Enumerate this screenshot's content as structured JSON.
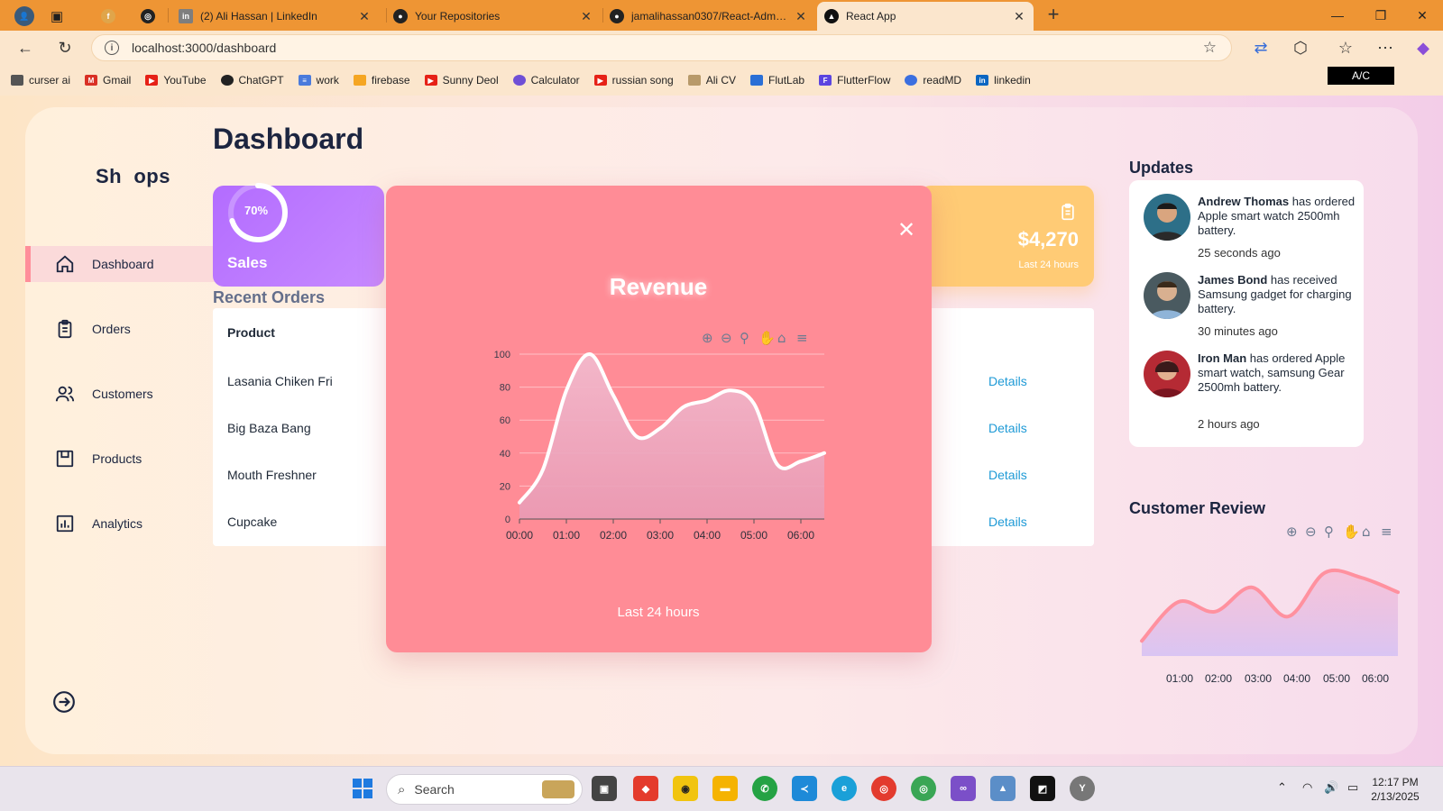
{
  "browser": {
    "tabs": [
      {
        "title": "",
        "kind": "profile"
      },
      {
        "title": "",
        "kind": "workspaces"
      },
      {
        "title": "",
        "kind": "pinned-f"
      },
      {
        "title": "",
        "kind": "pinned-chatgpt"
      },
      {
        "title": "(2) Ali Hassan | LinkedIn",
        "close": "✕"
      },
      {
        "title": "Your Repositories",
        "close": "✕"
      },
      {
        "title": "jamalihassan0307/React-Admin-D",
        "close": "✕"
      },
      {
        "title": "React App",
        "close": "✕"
      }
    ],
    "url": "localhost:3000/dashboard",
    "bookmarks": [
      "curser ai",
      "Gmail",
      "YouTube",
      "ChatGPT",
      "work",
      "firebase",
      "Sunny Deol",
      "Calculator",
      "russian song",
      "Ali CV",
      "FlutLab",
      "FlutterFlow",
      "readMD",
      "linkedin"
    ],
    "ac_label": "A/C"
  },
  "sidebar": {
    "logo": "Sh  ops",
    "items": [
      {
        "label": "Dashboard",
        "icon": "home-icon",
        "active": true
      },
      {
        "label": "Orders",
        "icon": "clipboard-icon",
        "active": false
      },
      {
        "label": "Customers",
        "icon": "users-icon",
        "active": false
      },
      {
        "label": "Products",
        "icon": "package-icon",
        "active": false
      },
      {
        "label": "Analytics",
        "icon": "bar-chart-icon",
        "active": false
      }
    ],
    "logout_icon": "sign-out-icon"
  },
  "main": {
    "title": "Dashboard",
    "cards": {
      "sales": {
        "label": "Sales",
        "percent": "70%",
        "progress": 0.7
      },
      "expenses": {
        "value": "$4,270",
        "sub": "Last 24 hours",
        "icon": "clipboard-icon"
      }
    },
    "recent_orders": {
      "title": "Recent Orders",
      "header": "Product",
      "rows": [
        {
          "product": "Lasania Chiken Fri",
          "action": "Details"
        },
        {
          "product": "Big Baza Bang",
          "action": "Details"
        },
        {
          "product": "Mouth Freshner",
          "action": "Details"
        },
        {
          "product": "Cupcake",
          "action": "Details"
        }
      ]
    }
  },
  "updates": {
    "title": "Updates",
    "items": [
      {
        "name": "Andrew Thomas",
        "text": " has ordered Apple smart watch 2500mh battery.",
        "time": "25 seconds ago"
      },
      {
        "name": "James Bond",
        "text": " has received Samsung gadget for charging battery.",
        "time": "30 minutes ago"
      },
      {
        "name": "Iron Man",
        "text": " has ordered Apple smart watch, samsung Gear 2500mh battery.",
        "time": "2 hours ago"
      }
    ]
  },
  "customer_review": {
    "title": "Customer Review",
    "toolbar_icons": [
      "zoom-in-icon",
      "zoom-out-icon",
      "search-zoom-icon",
      "pan-hand-icon",
      "home-icon",
      "menu-icon"
    ],
    "chart_data": {
      "type": "area",
      "x": [
        "01:00",
        "02:00",
        "03:00",
        "04:00",
        "05:00",
        "06:00"
      ],
      "series": [
        {
          "values": [
            10,
            50,
            40,
            65,
            35,
            80,
            75,
            60
          ]
        }
      ]
    }
  },
  "modal": {
    "title": "Revenue",
    "close": "✕",
    "footer": "Last 24 hours",
    "toolbar_icons": [
      "zoom-in-icon",
      "zoom-out-icon",
      "search-zoom-icon",
      "pan-hand-icon",
      "home-icon",
      "menu-icon"
    ],
    "chart_data": {
      "type": "area",
      "title": "Revenue",
      "x": [
        "00:00",
        "01:00",
        "02:00",
        "03:00",
        "04:00",
        "05:00",
        "06:00"
      ],
      "x_points": [
        "00:00",
        "00:30",
        "01:00",
        "01:30",
        "02:00",
        "02:30",
        "03:00",
        "03:30",
        "04:00",
        "04:30",
        "05:00",
        "05:30",
        "06:00",
        "06:30"
      ],
      "series": [
        {
          "values": [
            10,
            30,
            78,
            100,
            75,
            50,
            55,
            68,
            72,
            78,
            70,
            33,
            35,
            40
          ]
        }
      ],
      "yticks": [
        0,
        20,
        40,
        60,
        80,
        100
      ],
      "ylim": [
        0,
        100
      ],
      "grid": true,
      "line_color": "#ffffff",
      "fill_color": "#e99bb5"
    }
  },
  "taskbar": {
    "search_placeholder": "Search",
    "time": "12:17 PM",
    "date": "2/13/2025"
  },
  "colors": {
    "accent_pink": "#ff8c96",
    "sales_purple": "#b36cff",
    "expense_orange": "#ffcb75",
    "link_blue": "#1e9ad6",
    "review_line": "#ff919f"
  }
}
